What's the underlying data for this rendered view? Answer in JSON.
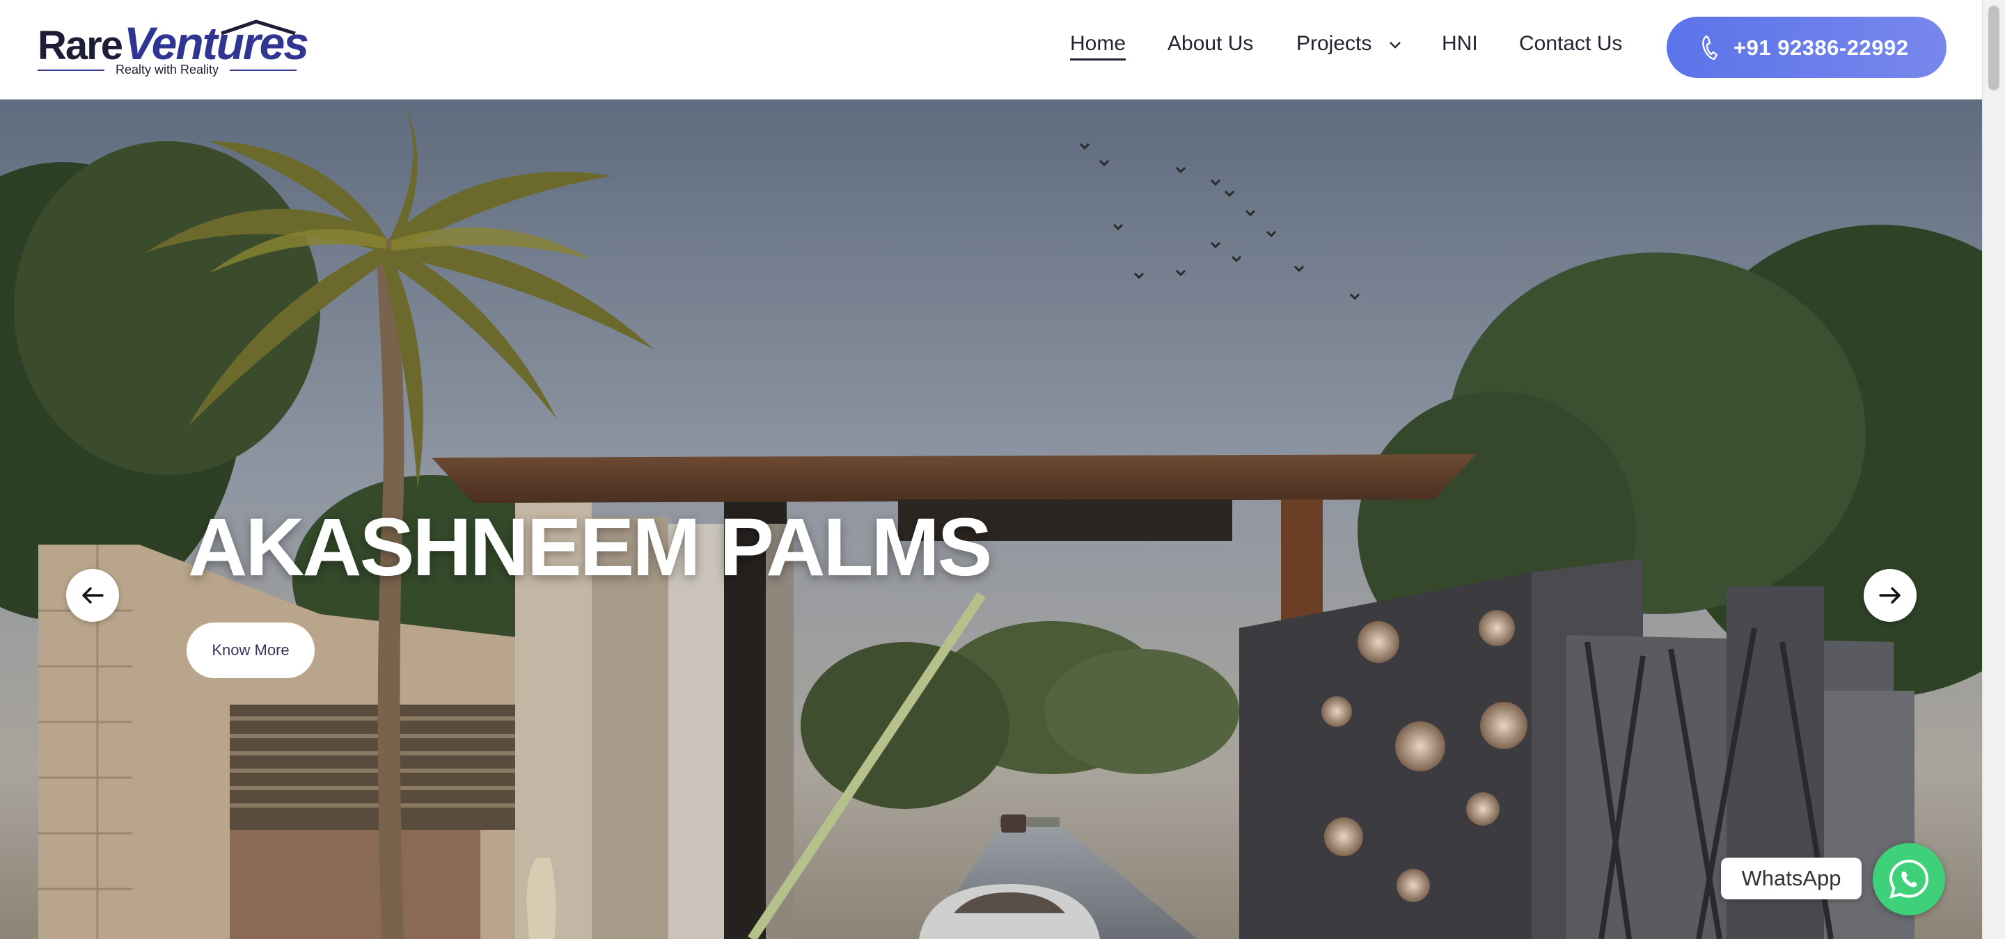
{
  "brand": {
    "name_part1": "Rare",
    "name_part2": "Ventures",
    "tagline": "Realty with Reality"
  },
  "nav": {
    "items": [
      {
        "label": "Home",
        "active": true
      },
      {
        "label": "About Us",
        "active": false
      },
      {
        "label": "Projects",
        "active": false,
        "has_dropdown": true
      },
      {
        "label": "HNI",
        "active": false
      },
      {
        "label": "Contact Us",
        "active": false
      }
    ],
    "phone_label": "+91 92386-22992",
    "phone_icon": "phone-icon"
  },
  "hero": {
    "title": "AKASHNEEM PALMS",
    "cta_label": "Know More",
    "prev_icon": "arrow-left-icon",
    "next_icon": "arrow-right-icon"
  },
  "whatsapp": {
    "label": "WhatsApp",
    "icon": "whatsapp-icon"
  },
  "colors": {
    "brand_dark": "#1d1d35",
    "brand_blue": "#2f3590",
    "cta_gradient_start": "#5b74ea",
    "cta_gradient_end": "#7887ec",
    "whatsapp_green": "#3fd17a"
  }
}
